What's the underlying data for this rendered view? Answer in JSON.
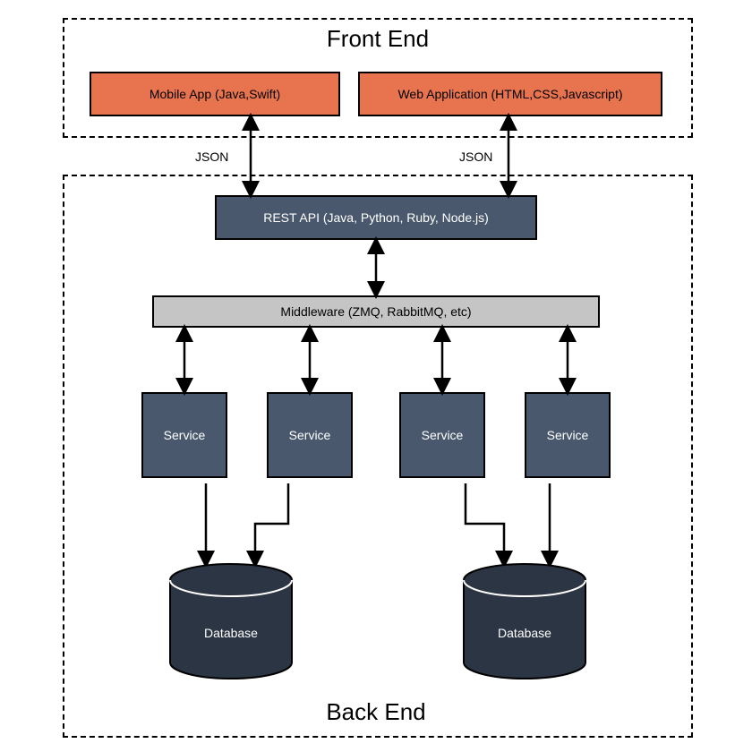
{
  "frontend": {
    "title": "Front End",
    "mobile": "Mobile App (Java,Swift)",
    "web": "Web Application (HTML,CSS,Javascript)"
  },
  "json_label_left": "JSON",
  "json_label_right": "JSON",
  "backend": {
    "title": "Back End",
    "rest_api": "REST API (Java, Python, Ruby, Node.js)",
    "middleware": "Middleware (ZMQ, RabbitMQ, etc)",
    "service1": "Service",
    "service2": "Service",
    "service3": "Service",
    "service4": "Service",
    "db1": "Database",
    "db2": "Database"
  }
}
